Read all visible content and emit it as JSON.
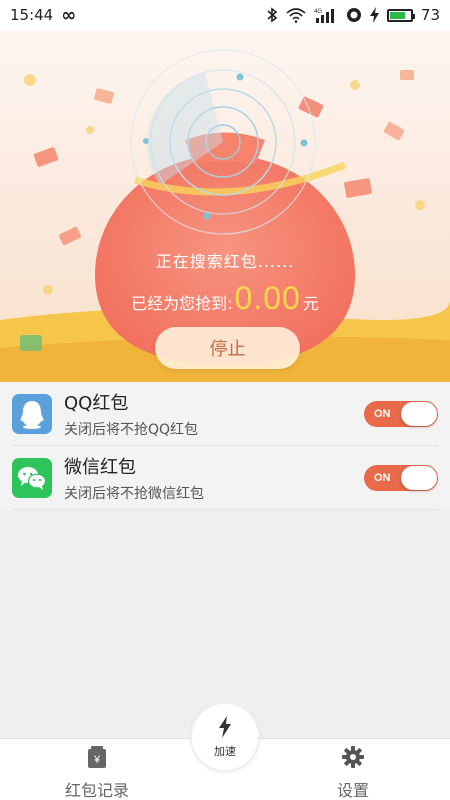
{
  "status_bar": {
    "time": "15:44",
    "infinity": "∞",
    "network_label": "4G",
    "battery_percent": 73,
    "battery_text": "73"
  },
  "hero": {
    "searching_text": "正在搜索红包......",
    "grabbed_prefix": "已经为您抢到:",
    "amount": "0.00",
    "currency": "元",
    "stop_label": "停止"
  },
  "apps": [
    {
      "title": "QQ红包",
      "subtitle": "关闭后将不抢QQ红包",
      "toggle": "ON",
      "enabled": true,
      "icon": "qq-icon"
    },
    {
      "title": "微信红包",
      "subtitle": "关闭后将不抢微信红包",
      "toggle": "ON",
      "enabled": true,
      "icon": "wechat-icon"
    }
  ],
  "bottom_nav": {
    "records_label": "红包记录",
    "speed_label": "加速",
    "settings_label": "设置"
  },
  "colors": {
    "accent": "#e86a4a",
    "amount": "#ffd84a",
    "qq": "#5aa0dc",
    "wechat": "#2ec45c"
  }
}
